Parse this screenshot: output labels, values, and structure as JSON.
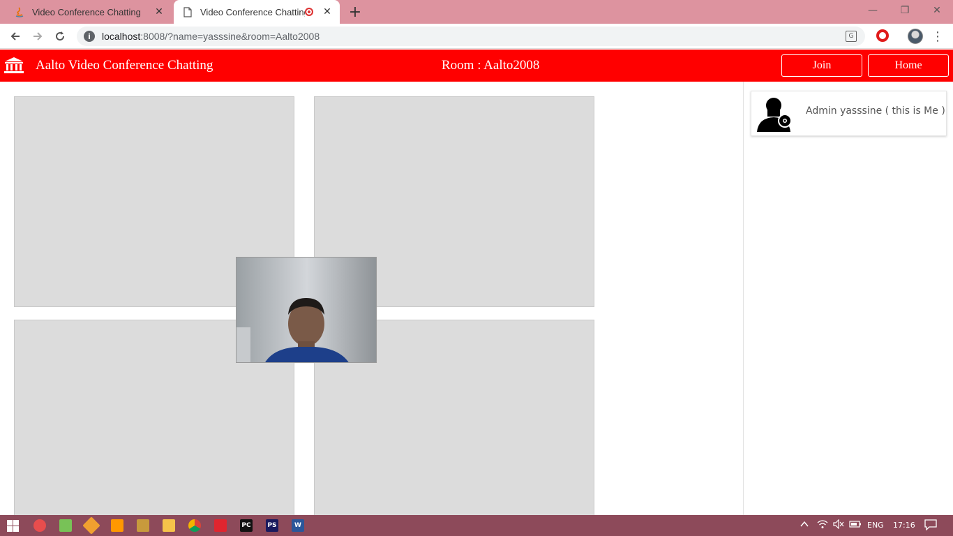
{
  "browser": {
    "tabs": [
      {
        "label": "Video Conference Chatting",
        "close": "✕"
      },
      {
        "label": "Video Conference Chatting",
        "close": "✕"
      }
    ],
    "new_tab": "+",
    "url_host": "localhost",
    "url_rest": ":8008/?name=yasssine&room=Aalto2008",
    "window_controls": {
      "minimize": "—",
      "maximize": "❐",
      "close": "✕"
    }
  },
  "app": {
    "title": "Aalto Video Conference Chatting",
    "room": "Room : Aalto2008",
    "join_label": "Join",
    "home_label": "Home",
    "brand_color": "#ff0000"
  },
  "participants": [
    {
      "name": "Admin yasssine ( this is Me )",
      "icon": "admin-user-icon"
    }
  ],
  "taskbar": {
    "language": "ENG",
    "time": "17:16",
    "apps": [
      "windows-start-icon",
      "app-icon",
      "android-studio-icon",
      "git-icon",
      "sublime-text-icon",
      "books-icon",
      "file-explorer-icon",
      "chrome-icon",
      "xampp-icon",
      "pycharm-icon",
      "phpstorm-icon",
      "word-icon"
    ],
    "app_labels": {
      "pycharm": "PC",
      "phpstorm": "PS",
      "word": "W"
    }
  }
}
